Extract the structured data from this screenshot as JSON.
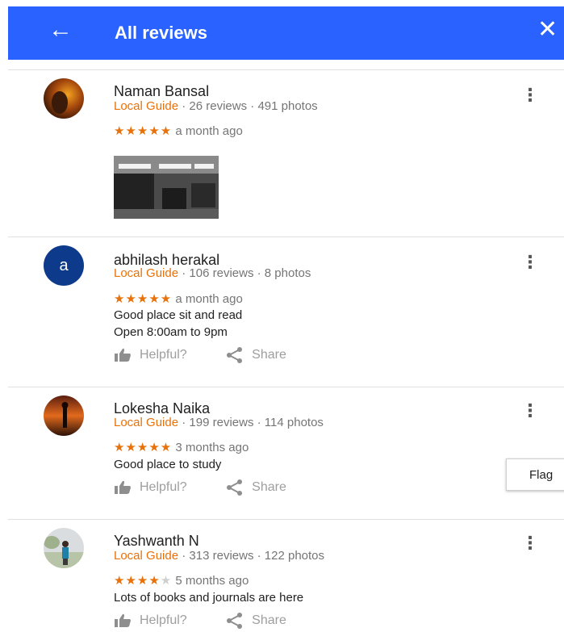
{
  "header": {
    "back_icon": "arrow-left-icon",
    "title": "All reviews",
    "close_icon": "close-icon"
  },
  "reviews": [
    {
      "name": "Naman Bansal",
      "guide": "Local Guide",
      "reviews_count": "26 reviews",
      "photos_count": "491 photos",
      "stars": "★★★★★",
      "stars_empty": "",
      "time": "a month ago",
      "text": []
    },
    {
      "name": "abhilash herakal",
      "avatar_letter": "a",
      "guide": "Local Guide",
      "reviews_count": "106 reviews",
      "photos_count": "8 photos",
      "stars": "★★★★★",
      "stars_empty": "",
      "time": "a month ago",
      "text": [
        "Good place sit and read",
        "Open 8:00am to 9pm"
      ]
    },
    {
      "name": "Lokesha Naika",
      "guide": "Local Guide",
      "reviews_count": "199 reviews",
      "photos_count": "114 photos",
      "stars": "★★★★★",
      "stars_empty": "",
      "time": "3 months ago",
      "text": [
        "Good place to study"
      ]
    },
    {
      "name": "Yashwanth N",
      "guide": "Local Guide",
      "reviews_count": "313 reviews",
      "photos_count": "122 photos",
      "stars": "★★★★",
      "stars_empty": "★",
      "time": "5 months ago",
      "text": [
        "Lots of books and journals are here"
      ]
    }
  ],
  "actions": {
    "helpful_label": "Helpful?",
    "share_label": "Share"
  },
  "separator": "·",
  "menu": {
    "flag_label": "Flag"
  },
  "colors": {
    "header_bg": "#2962ff",
    "guide": "#e8710a",
    "stars": "#e8710a"
  }
}
